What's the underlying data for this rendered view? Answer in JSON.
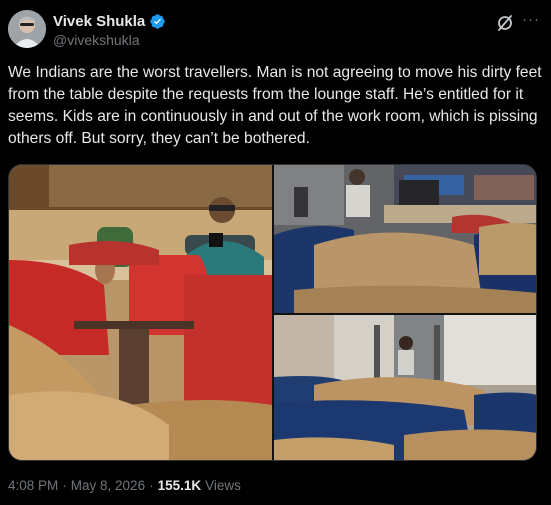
{
  "author": {
    "name": "Vivek Shukla",
    "handle": "@vivekshukla",
    "verified": true
  },
  "icons": {
    "verified": "verified-badge-icon",
    "grok": "grok-icon",
    "more": "more-options-icon"
  },
  "tweet": {
    "text": "We Indians are the worst travellers. Man is not agreeing to move his dirty feet from the table despite the requests from the lounge staff. He’s entitled for it seems. Kids are in continuously in and out of the work room, which is pissing others off. But sorry, they can’t be bothered."
  },
  "media": {
    "photo_count": 3
  },
  "meta": {
    "time": "4:08 PM",
    "separator1": "·",
    "date": "May 8, 2026",
    "separator2": "·",
    "views_count": "155.1K",
    "views_label": "Views"
  },
  "colors": {
    "background": "#000000",
    "text_primary": "#e7e9ea",
    "text_secondary": "#71767b",
    "verified_blue": "#1d9bf0",
    "border": "#2f3336"
  }
}
